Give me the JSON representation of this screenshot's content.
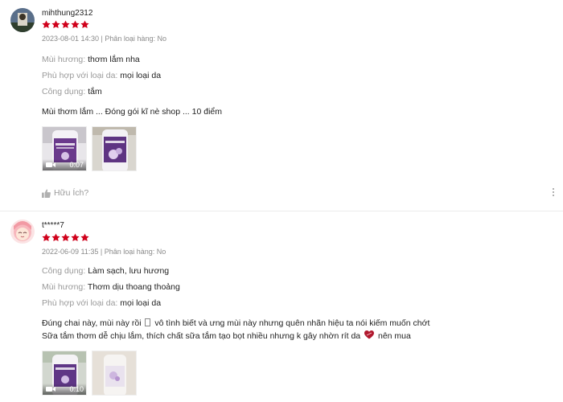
{
  "colors": {
    "star": "#d0011b",
    "muted": "#9a9a9a",
    "text": "#222222"
  },
  "reviews": [
    {
      "username": "mihthung2312",
      "rating": 5,
      "meta": "2023-08-01 14:30 | Phân loại hàng: No",
      "attributes": [
        {
          "key": "Mùi hương:",
          "value": "thơm lắm nha"
        },
        {
          "key": "Phù hợp với loại da:",
          "value": "mọi loại da"
        },
        {
          "key": "Công dụng:",
          "value": "tắm"
        }
      ],
      "body": "Mùi thơm lắm ... Đóng gói kĩ nè shop ... 10 điểm",
      "media": [
        {
          "type": "video",
          "duration": "0:07"
        },
        {
          "type": "image"
        }
      ],
      "helpful_label": "Hữu Ích?"
    },
    {
      "username": "t*****7",
      "rating": 5,
      "meta": "2022-06-09 11:35 | Phân loại hàng: No",
      "attributes": [
        {
          "key": "Công dụng:",
          "value": "Làm sạch, lưu hương"
        },
        {
          "key": "Mùi hương:",
          "value": "Thơm dịu thoang thoảng"
        },
        {
          "key": "Phù hợp với loại da:",
          "value": "mọi loại da"
        }
      ],
      "body_line1_a": "Đúng chai này, mùi này rồi",
      "body_line1_b": "vô tình biết và ưng mùi này nhưng quên nhãn hiệu ta nói kiếm muốn chớt",
      "body_line2_a": "Sữa tắm thơm dễ chịu lắm, thích chất sữa tắm tạo bọt nhiều nhưng k gây nhờn rít da",
      "body_line2_b": "nên mua",
      "media": [
        {
          "type": "video",
          "duration": "0:10"
        },
        {
          "type": "image"
        }
      ]
    }
  ]
}
